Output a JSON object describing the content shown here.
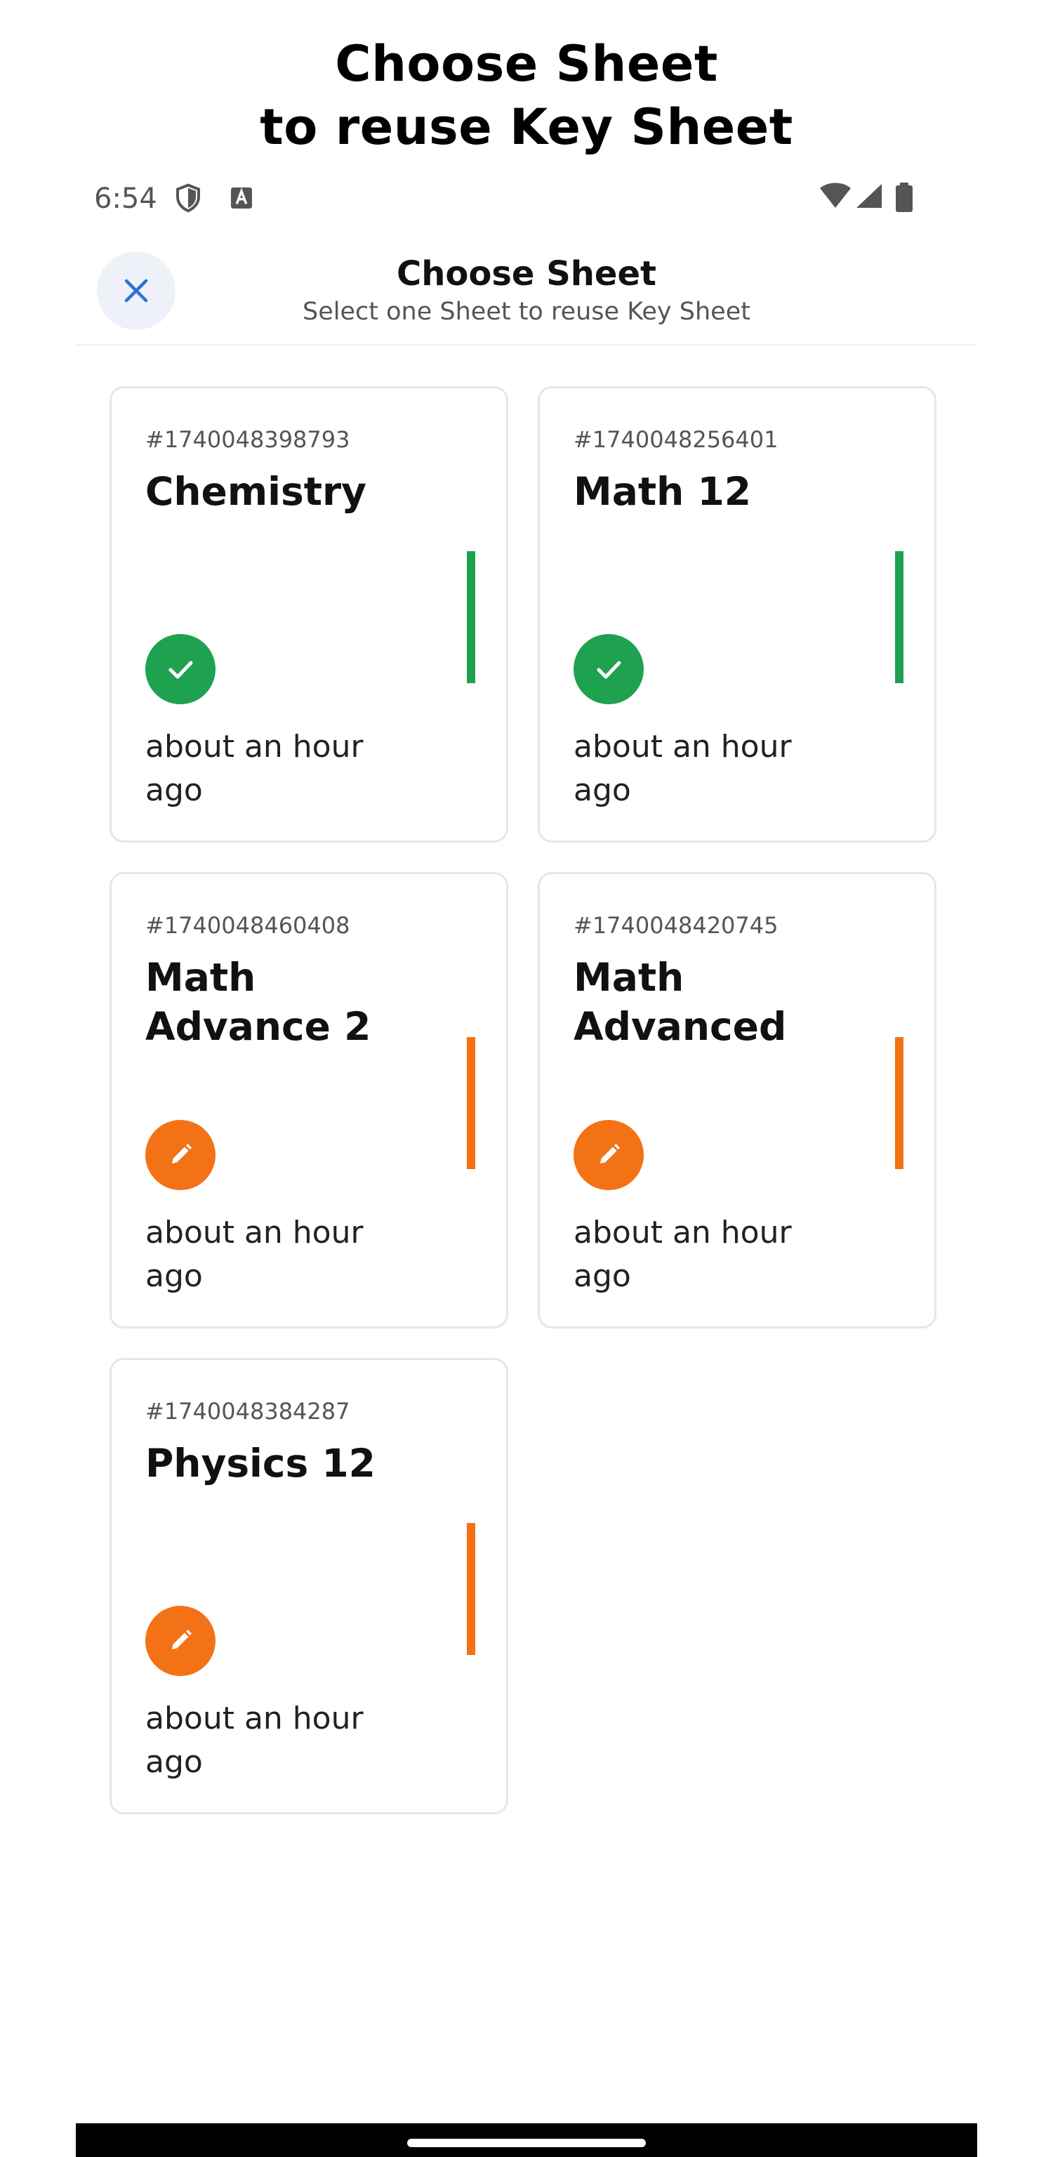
{
  "caption": {
    "line1": "Choose Sheet",
    "line2": "to reuse Key Sheet"
  },
  "status_bar": {
    "time": "6:54",
    "left_icons": [
      "shield-icon",
      "keyboard-a-icon"
    ],
    "right_icons": [
      "wifi-icon",
      "cell-signal-icon",
      "battery-icon"
    ]
  },
  "header": {
    "title": "Choose Sheet",
    "subtitle": "Select one Sheet to reuse Key Sheet",
    "close_icon": "close-icon"
  },
  "colors": {
    "done": "#1ea24f",
    "draft": "#f47216",
    "close_icon": "#2f6fd9"
  },
  "sheets": [
    {
      "id": "#1740048398793",
      "title": "Chemistry",
      "status": "done",
      "icon": "check-icon",
      "time": "about an hour ago"
    },
    {
      "id": "#1740048256401",
      "title": "Math 12",
      "status": "done",
      "icon": "check-icon",
      "time": "about an hour ago"
    },
    {
      "id": "#1740048460408",
      "title": "Math Advance 2",
      "status": "draft",
      "icon": "pencil-icon",
      "time": "about an hour ago"
    },
    {
      "id": "#1740048420745",
      "title": "Math Advanced",
      "status": "draft",
      "icon": "pencil-icon",
      "time": "about an hour ago"
    },
    {
      "id": "#1740048384287",
      "title": "Physics 12",
      "status": "draft",
      "icon": "pencil-icon",
      "time": "about an hour ago"
    }
  ]
}
